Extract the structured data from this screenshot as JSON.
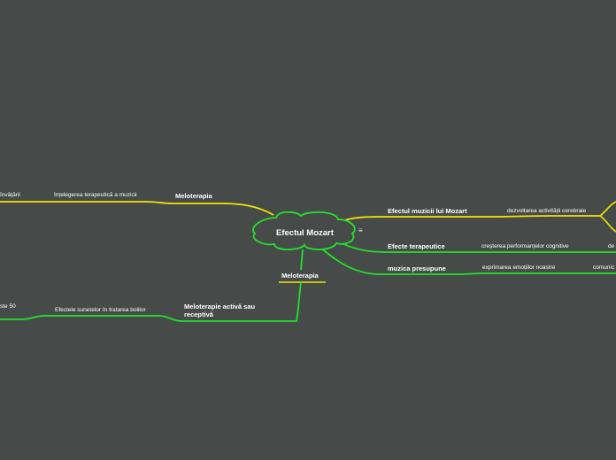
{
  "center": {
    "title": "Efectul Mozart",
    "menu_icon": "≡"
  },
  "nodes": {
    "right_top": {
      "title": "Efectul muzicii  lui Mozart",
      "child": "dezvoltarea activității cerebrale"
    },
    "right_mid": {
      "title": "Efecte terapeutice",
      "child": "creșterea performanțelor cognitive",
      "child2": "de"
    },
    "right_bot": {
      "title": "muzica presupune",
      "child": "exprimarea emoțiilor noastre",
      "child2": "comunic"
    },
    "left_top": {
      "title": "Meloterapia",
      "child": "înțelegerea terapeutică a muzicii",
      "child2": "învățării"
    },
    "bottom": {
      "title": "Meloterapia"
    },
    "left_bot": {
      "title_line1": "Meloterapie activă sau",
      "title_line2": "receptivă",
      "child": "Efectele sunetelor în tratarea bolilor",
      "child2": "ste 50"
    }
  },
  "colors": {
    "background": "#464b4a",
    "yellow": "#f2e600",
    "green": "#22e22b",
    "text": "#ffffff"
  }
}
